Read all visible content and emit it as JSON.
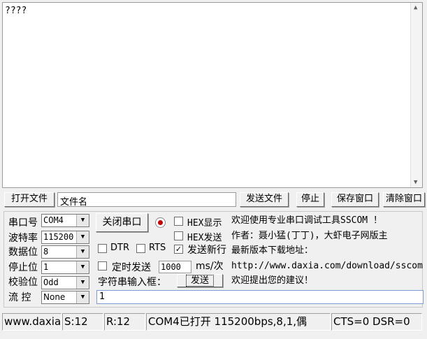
{
  "receive_area": {
    "text": "????"
  },
  "file_bar": {
    "open_file_button": "打开文件",
    "filename_value": "文件名",
    "send_file_button": "发送文件",
    "stop_button": "停止",
    "save_window_button": "保存窗口",
    "clear_window_button": "清除窗口"
  },
  "settings": {
    "port_label": "串口号",
    "port_value": "COM4",
    "baud_label": "波特率",
    "baud_value": "115200",
    "databits_label": "数据位",
    "databits_value": "8",
    "stopbits_label": "停止位",
    "stopbits_value": "1",
    "parity_label": "校验位",
    "parity_value": "Odd",
    "flow_label": "流 控",
    "flow_value": "None"
  },
  "controls": {
    "close_port_button": "关闭串口",
    "hex_display_label": "HEX显示",
    "hex_send_label": "HEX发送",
    "dtr_label": "DTR",
    "rts_label": "RTS",
    "send_newline_label": "发送新行",
    "send_newline_checked": "✓",
    "timed_send_label": "定时发送",
    "interval_value": "1000",
    "interval_unit": "ms/次",
    "string_input_label": "字符串输入框：",
    "send_button": "发送",
    "send_input_value": "1"
  },
  "info": {
    "line1": "欢迎使用专业串口调试工具SSCOM ！",
    "line2": "作者：聂小猛(丁丁)，大虾电子网版主",
    "line3": "最新版本下载地址：",
    "line4": "http://www.daxia.com/download/sscom.rar",
    "line5": "欢迎提出您的建议！"
  },
  "status_bar": {
    "website": "www.daxia.com",
    "sent": "S:12",
    "received": "R:12",
    "port_status": "COM4已打开  115200bps,8,1,偶",
    "cts_dsr": "CTS=0 DSR=0"
  },
  "colors": {
    "accent_blue": "#7a9cd3",
    "led_red": "#c00000"
  }
}
